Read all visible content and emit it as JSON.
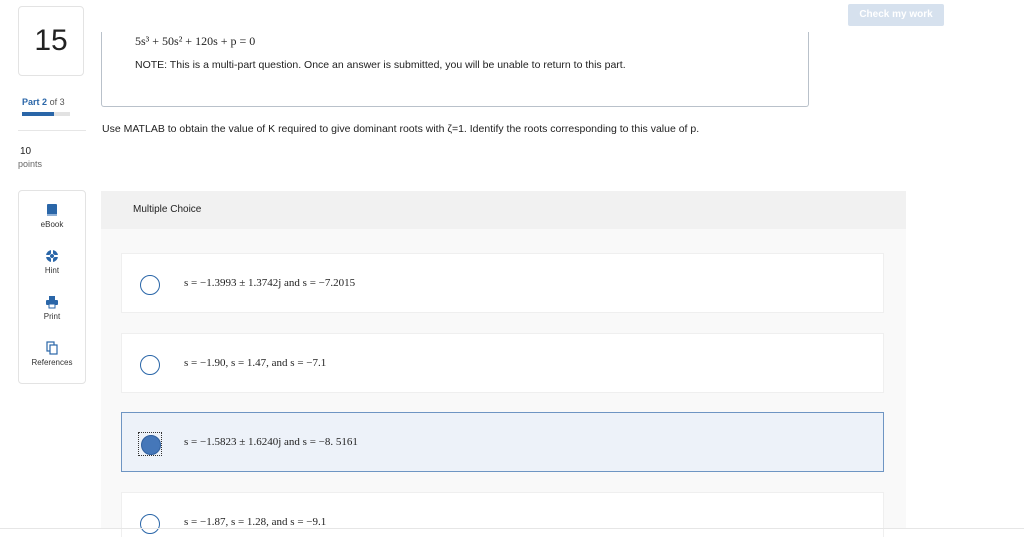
{
  "header": {
    "check_button": "Check my work"
  },
  "rail": {
    "question_number": "15",
    "part_prefix": "Part",
    "part_current": "2",
    "part_of": "of 3",
    "part_progress": 0.6667,
    "points_value": "10",
    "points_label": "points",
    "tools": [
      {
        "label": "eBook",
        "icon": "book-icon"
      },
      {
        "label": "Hint",
        "icon": "lifebuoy-icon"
      },
      {
        "label": "Print",
        "icon": "printer-icon"
      },
      {
        "label": "References",
        "icon": "copy-icon"
      }
    ]
  },
  "question": {
    "equation": "5s³ + 50s² + 120s + p = 0",
    "note": "NOTE: This is a multi-part question. Once an answer is submitted, you will be unable to return to this part.",
    "prompt": "Use MATLAB to obtain the value of K required to give dominant roots with ζ=1. Identify the roots corresponding to this value of p."
  },
  "multiple_choice": {
    "header": "Multiple Choice",
    "selected_index": 2,
    "options": [
      "s = −1.3993 ± 1.3742j  and s = −7.2015",
      "s = −1.90, s = 1.47, and s = −7.1",
      "s = −1.5823 ± 1.6240j  and s = −8. 5161",
      "s = −1.87, s = 1.28, and s = −9.1"
    ]
  },
  "colors": {
    "accent": "#2a66a8",
    "selected_fill": "#4577b9",
    "selected_bg": "#edf2f9",
    "button_disabled": "#d6e1ee"
  }
}
